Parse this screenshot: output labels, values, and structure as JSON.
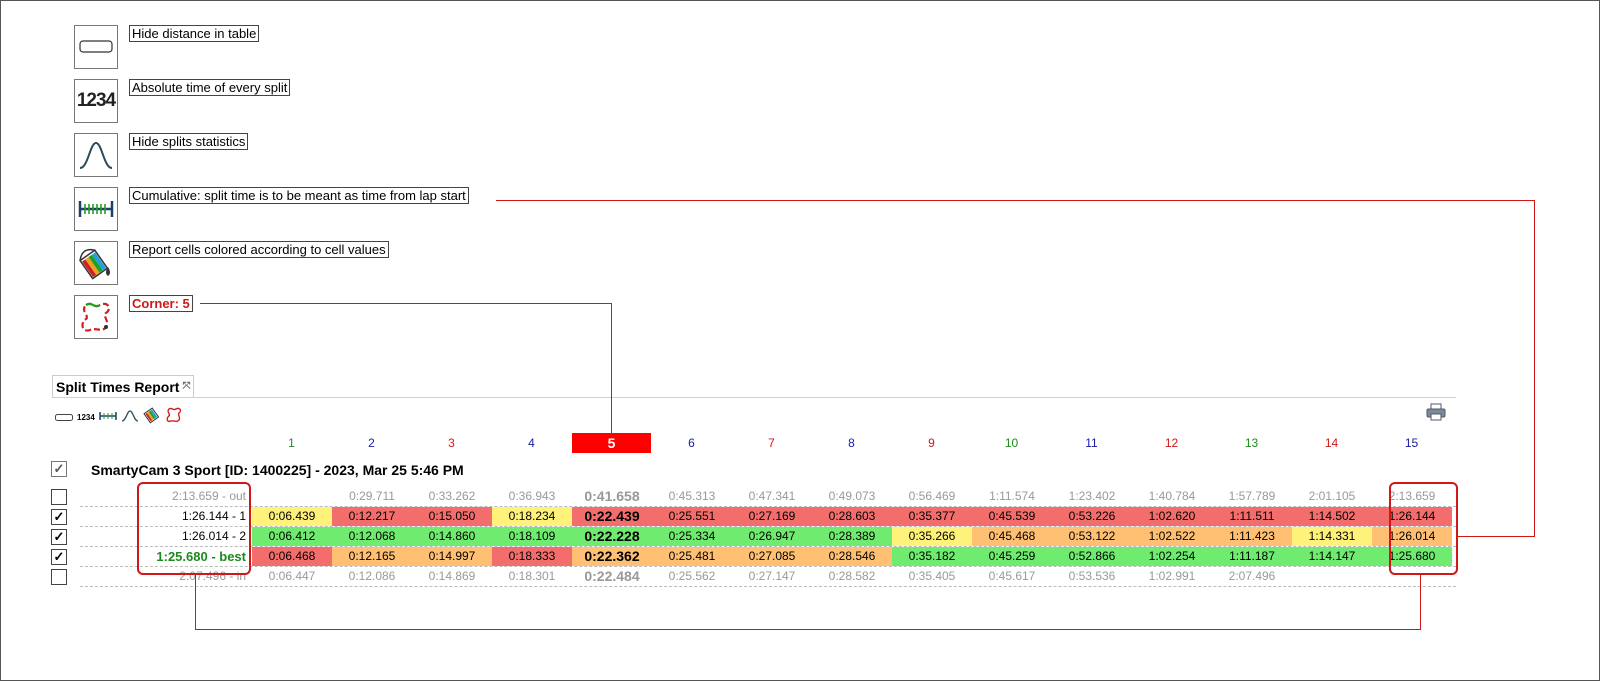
{
  "legend": {
    "hide_distance": "Hide distance in table",
    "absolute_time": "Absolute time of every split",
    "absolute_icon_text": "1234",
    "hide_stats": "Hide splits statistics",
    "cumulative": "Cumulative: split time is to be meant as time from lap start",
    "colored": "Report cells colored according to cell values",
    "corner": "Corner: 5"
  },
  "report": {
    "tab_title": "Split Times Report",
    "tab_close": "⤧",
    "toolbar_abs_text": "1234",
    "device_title": "SmartyCam 3 Sport [ID: 1400225] - 2023, Mar 25 5:46 PM",
    "selected_split": 5,
    "columns": [
      {
        "label": "1",
        "color": "#1e8a1e"
      },
      {
        "label": "2",
        "color": "#1a1aa0"
      },
      {
        "label": "3",
        "color": "#d01818"
      },
      {
        "label": "4",
        "color": "#1a1aa0"
      },
      {
        "label": "5",
        "color": "#ffffff"
      },
      {
        "label": "6",
        "color": "#1a1aa0"
      },
      {
        "label": "7",
        "color": "#d01818"
      },
      {
        "label": "8",
        "color": "#1a1aa0"
      },
      {
        "label": "9",
        "color": "#d01818"
      },
      {
        "label": "10",
        "color": "#1e8a1e"
      },
      {
        "label": "11",
        "color": "#1a1aa0"
      },
      {
        "label": "12",
        "color": "#d01818"
      },
      {
        "label": "13",
        "color": "#1e8a1e"
      },
      {
        "label": "14",
        "color": "#d01818"
      },
      {
        "label": "15",
        "color": "#1a1aa0"
      }
    ],
    "rows": [
      {
        "label": "2:13.659 - out",
        "checked": false,
        "style": "grey",
        "cells": [
          "",
          "0:29.711",
          "0:33.262",
          "0:36.943",
          "0:41.658",
          "0:45.313",
          "0:47.341",
          "0:49.073",
          "0:56.469",
          "1:11.574",
          "1:23.402",
          "1:40.784",
          "1:57.789",
          "2:01.105",
          "2:13.659"
        ],
        "colors": [
          "",
          "",
          "",
          "",
          "",
          "",
          "",
          "",
          "",
          "",
          "",
          "",
          "",
          "",
          ""
        ]
      },
      {
        "label": "1:26.144 - 1",
        "checked": true,
        "style": "normal",
        "cells": [
          "0:06.439",
          "0:12.217",
          "0:15.050",
          "0:18.234",
          "0:22.439",
          "0:25.551",
          "0:27.169",
          "0:28.603",
          "0:35.377",
          "0:45.539",
          "0:53.226",
          "1:02.620",
          "1:11.511",
          "1:14.502",
          "1:26.144"
        ],
        "colors": [
          "yellow",
          "red",
          "red",
          "yellow",
          "red",
          "red",
          "red",
          "red",
          "red",
          "red",
          "red",
          "red",
          "red",
          "red",
          "red"
        ]
      },
      {
        "label": "1:26.014 - 2",
        "checked": true,
        "style": "normal",
        "cells": [
          "0:06.412",
          "0:12.068",
          "0:14.860",
          "0:18.109",
          "0:22.228",
          "0:25.334",
          "0:26.947",
          "0:28.389",
          "0:35.266",
          "0:45.468",
          "0:53.122",
          "1:02.522",
          "1:11.423",
          "1:14.331",
          "1:26.014"
        ],
        "colors": [
          "green",
          "green",
          "green",
          "green",
          "green",
          "green",
          "green",
          "green",
          "yellow",
          "orange",
          "orange",
          "orange",
          "orange",
          "yellow",
          "orange"
        ]
      },
      {
        "label": "1:25.680 - best",
        "checked": true,
        "style": "best",
        "cells": [
          "0:06.468",
          "0:12.165",
          "0:14.997",
          "0:18.333",
          "0:22.362",
          "0:25.481",
          "0:27.085",
          "0:28.546",
          "0:35.182",
          "0:45.259",
          "0:52.866",
          "1:02.254",
          "1:11.187",
          "1:14.147",
          "1:25.680"
        ],
        "colors": [
          "red",
          "orange",
          "orange",
          "red",
          "orange",
          "orange",
          "orange",
          "orange",
          "green",
          "green",
          "green",
          "green",
          "green",
          "green",
          "green"
        ]
      },
      {
        "label": "2:07.496 - in",
        "checked": false,
        "style": "grey",
        "cells": [
          "0:06.447",
          "0:12.086",
          "0:14.869",
          "0:18.301",
          "0:22.484",
          "0:25.562",
          "0:27.147",
          "0:28.582",
          "0:35.405",
          "0:45.617",
          "0:53.536",
          "1:02.991",
          "2:07.496",
          "",
          ""
        ],
        "colors": [
          "",
          "",
          "",
          "",
          "",
          "",
          "",
          "",
          "",
          "",
          "",
          "",
          "",
          "",
          ""
        ]
      }
    ]
  },
  "colors": {
    "accent": "#d01818",
    "red_cell": "#f46d6d",
    "orange_cell": "#ffc073",
    "yellow_cell": "#fff27a",
    "green_cell": "#6fec6f"
  }
}
